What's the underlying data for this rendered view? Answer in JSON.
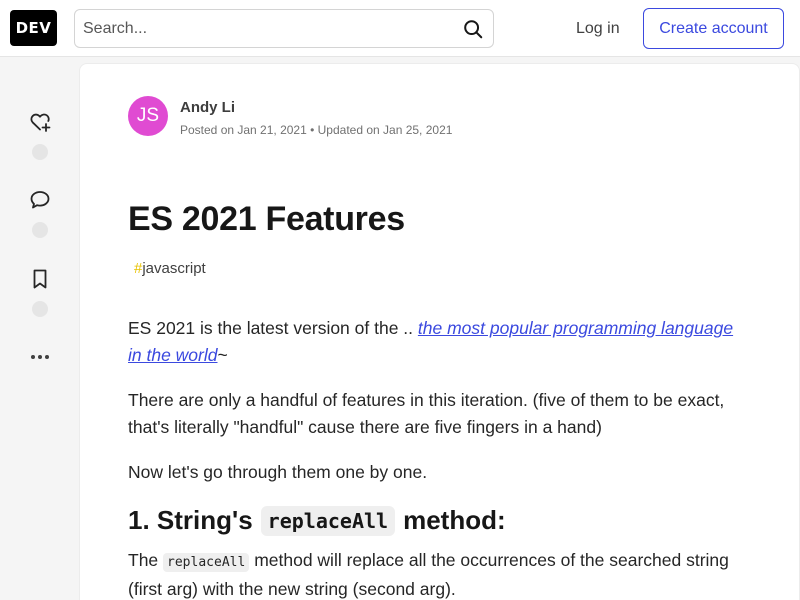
{
  "header": {
    "logo": "DEV",
    "search_placeholder": "Search...",
    "login_label": "Log in",
    "create_account_label": "Create account"
  },
  "sidebar_actions": [
    {
      "name": "like",
      "icon": "heart-plus-icon"
    },
    {
      "name": "comment",
      "icon": "comment-icon"
    },
    {
      "name": "save",
      "icon": "bookmark-icon"
    },
    {
      "name": "more",
      "icon": "more-horizontal-icon"
    }
  ],
  "article": {
    "avatar_initials": "JS",
    "author": "Andy Li",
    "meta": "Posted on Jan 21, 2021 • Updated on Jan 25, 2021",
    "title": "ES 2021 Features",
    "tag_hash": "#",
    "tag": "javascript",
    "p1_prefix": "ES 2021 is the latest version of the .. ",
    "p1_link": "the most popular programming language in the world",
    "p1_suffix": "~",
    "p2": "There are only a handful of features in this iteration. (five of them to be exact, that's literally \"handful\" cause there are five fingers in a hand)",
    "p3": "Now let's go through them one by one.",
    "h2_prefix": "1. String's",
    "h2_code": "replaceAll",
    "h2_suffix": "method:",
    "p4_prefix": "The",
    "p4_code": "replaceAll",
    "p4_suffix": "method will replace all the occurrences of the searched string (first arg) with the new string (second arg)."
  },
  "colors": {
    "accent": "#3b49df",
    "avatar_bg": "#e04bd2",
    "tag_hash": "#e8c200"
  }
}
